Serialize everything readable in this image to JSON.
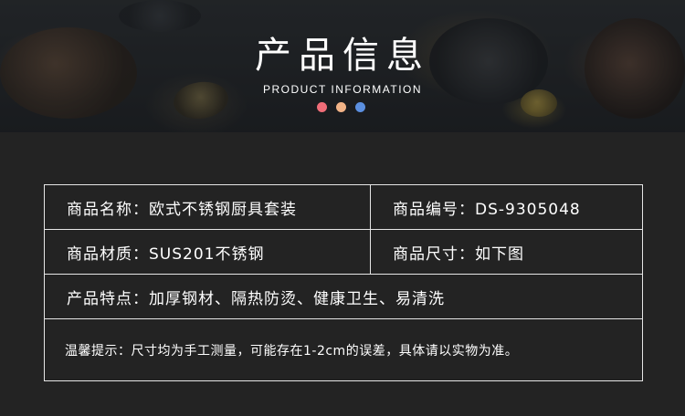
{
  "header": {
    "title": "产品信息",
    "subtitle": "PRODUCT INFORMATION",
    "dots": [
      "#f06d78",
      "#f2b387",
      "#5b8fe0"
    ]
  },
  "info": {
    "name_label": "商品名称：欧式不锈钢厨具套装",
    "code_label": "商品编号：DS-9305048",
    "material_label": "商品材质：SUS201不锈钢",
    "size_label": "商品尺寸：如下图",
    "features_label": "产品特点：加厚钢材、隔热防烫、健康卫生、易清洗",
    "note": "温馨提示：尺寸均为手工测量，可能存在1-2cm的误差，具体请以实物为准。"
  }
}
